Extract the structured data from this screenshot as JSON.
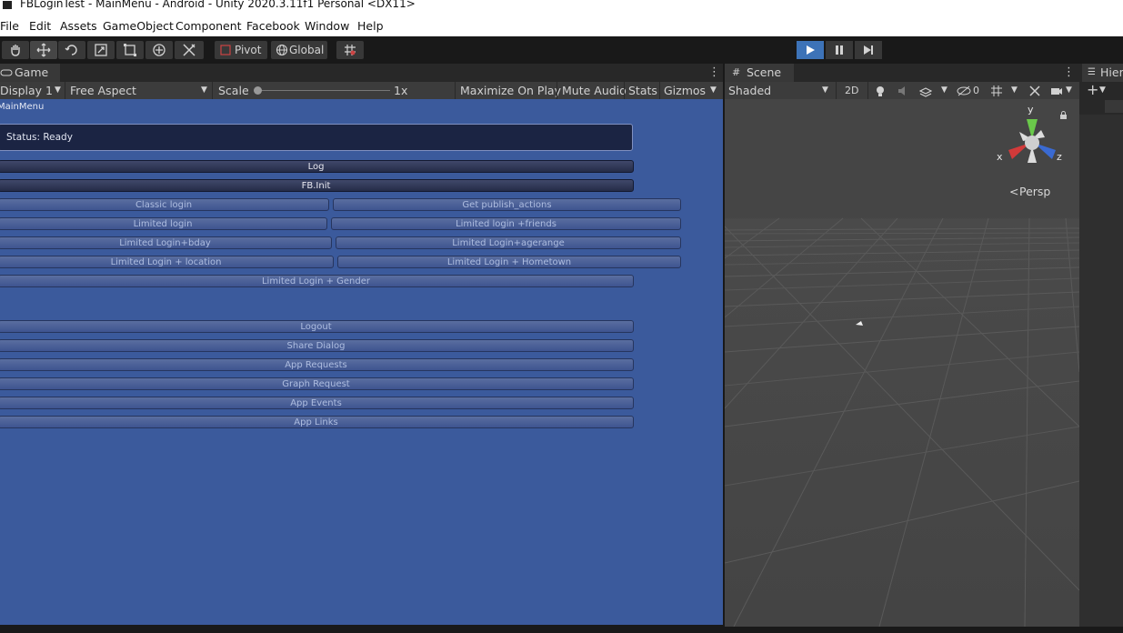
{
  "window": {
    "title": "FBLoginTest - MainMenu - Android - Unity 2020.3.11f1 Personal <DX11>"
  },
  "menu": [
    "File",
    "Edit",
    "Assets",
    "GameObject",
    "Component",
    "Facebook",
    "Window",
    "Help"
  ],
  "toolbar": {
    "tools": [
      "hand-icon",
      "move-icon",
      "rotate-icon",
      "scale-icon",
      "rect-icon",
      "transform-icon",
      "custom-tool-icon"
    ],
    "pivot_label": "Pivot",
    "global_label": "Global",
    "snap_icon": "grid-snap-icon",
    "play_icons": [
      "play-icon",
      "pause-icon",
      "step-icon"
    ]
  },
  "game": {
    "tab_label": "Game",
    "display": "Display 1",
    "aspect": "Free Aspect",
    "scale_label": "Scale",
    "scale_value": "1x",
    "scale_fraction": 0.0,
    "maximize_label": "Maximize On Play",
    "mute_label": "Mute Audio",
    "stats_label": "Stats",
    "gizmos_label": "Gizmos",
    "scene_label": "MainMenu",
    "status": "Status: Ready",
    "buttons": {
      "log": "Log",
      "init": "FB.Init",
      "classic_login": "Classic login",
      "publish_actions": "Get publish_actions",
      "limited_login": "Limited login",
      "limited_friends": "Limited login +friends",
      "limited_bday": "Limited Login+bday",
      "limited_agerange": "Limited Login+agerange",
      "limited_location": "Limited Login + location",
      "limited_hometown": "Limited Login + Hometown",
      "limited_gender": "Limited Login + Gender",
      "logout": "Logout",
      "share_dialog": "Share Dialog",
      "app_requests": "App Requests",
      "graph_request": "Graph Request",
      "app_events": "App Events",
      "app_links": "App Links"
    }
  },
  "scene": {
    "tab_label": "Scene",
    "shading": "Shaded",
    "mode_2d": "2D",
    "hidden_count": "0",
    "persp_label": "Persp",
    "axes": {
      "x": "x",
      "y": "y",
      "z": "z"
    }
  },
  "hierarchy": {
    "tab_label": "Hier"
  },
  "colors": {
    "play_accent": "#3d73b8",
    "game_bg": "#3b5a9c",
    "status_bg": "#1b2443"
  }
}
